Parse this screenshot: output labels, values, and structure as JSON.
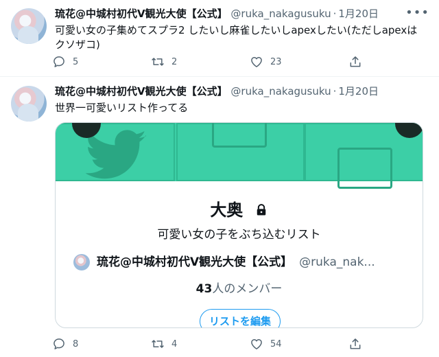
{
  "tweets": [
    {
      "author_name": "琉花@中城村初代V観光大使【公式】",
      "handle": "@ruka_nakagusuku",
      "date": "1月20日",
      "text": "可愛い女の子集めてスプラ2 したいし麻雀したいしapexしたい(ただしapexはクソザコ)",
      "replies": "5",
      "retweets": "2",
      "likes": "23"
    },
    {
      "author_name": "琉花@中城村初代V観光大使【公式】",
      "handle": "@ruka_nakagusuku",
      "date": "1月20日",
      "text": "世界一可愛いリスト作ってる",
      "replies": "8",
      "retweets": "4",
      "likes": "54",
      "list_card": {
        "name": "大奥",
        "description": "可愛い女の子をぶち込むリスト",
        "owner_name": "琉花@中城村初代V観光大使【公式】",
        "owner_handle": "@ruka_nak...",
        "member_count": "43",
        "member_suffix": "人のメンバー",
        "edit_button": "リストを編集",
        "banner_color": "#3ccfa6"
      }
    }
  ],
  "icons": [
    "more-icon",
    "reply-icon",
    "retweet-icon",
    "like-icon",
    "share-icon",
    "lock-icon",
    "twitter-bird-icon"
  ],
  "colors": {
    "accent": "#1d9bf0",
    "secondary_text": "#536471",
    "border": "#cfd9de"
  }
}
